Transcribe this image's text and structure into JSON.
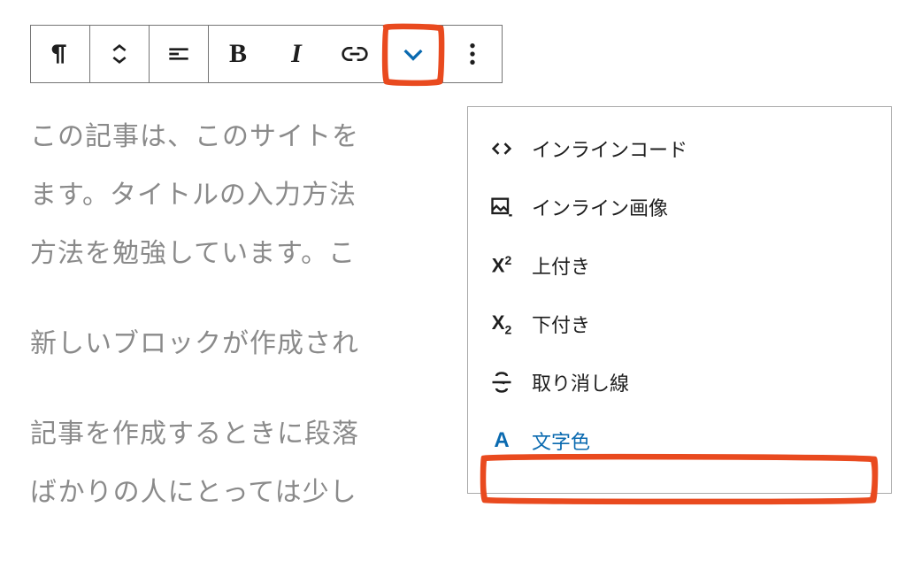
{
  "toolbar": {
    "bold_glyph": "B",
    "italic_glyph": "I"
  },
  "content": {
    "p1": "この記事は、このサイトを",
    "p2": "ます。タイトルの入力方法",
    "p3": "方法を勉強しています。こ",
    "p4": "新しいブロックが作成され",
    "p5": "記事を作成するときに段落",
    "p6": "ばかりの人にとっては少し"
  },
  "dropdown": {
    "items": [
      {
        "label": "インラインコード",
        "iconName": "code-icon"
      },
      {
        "label": "インライン画像",
        "iconName": "image-icon"
      },
      {
        "label": "上付き",
        "iconName": "superscript-icon"
      },
      {
        "label": "下付き",
        "iconName": "subscript-icon"
      },
      {
        "label": "取り消し線",
        "iconName": "strikethrough-icon"
      },
      {
        "label": "文字色",
        "iconName": "text-color-icon"
      }
    ]
  },
  "colors": {
    "accent": "#0a6ab0",
    "highlight": "#e94a1f"
  }
}
